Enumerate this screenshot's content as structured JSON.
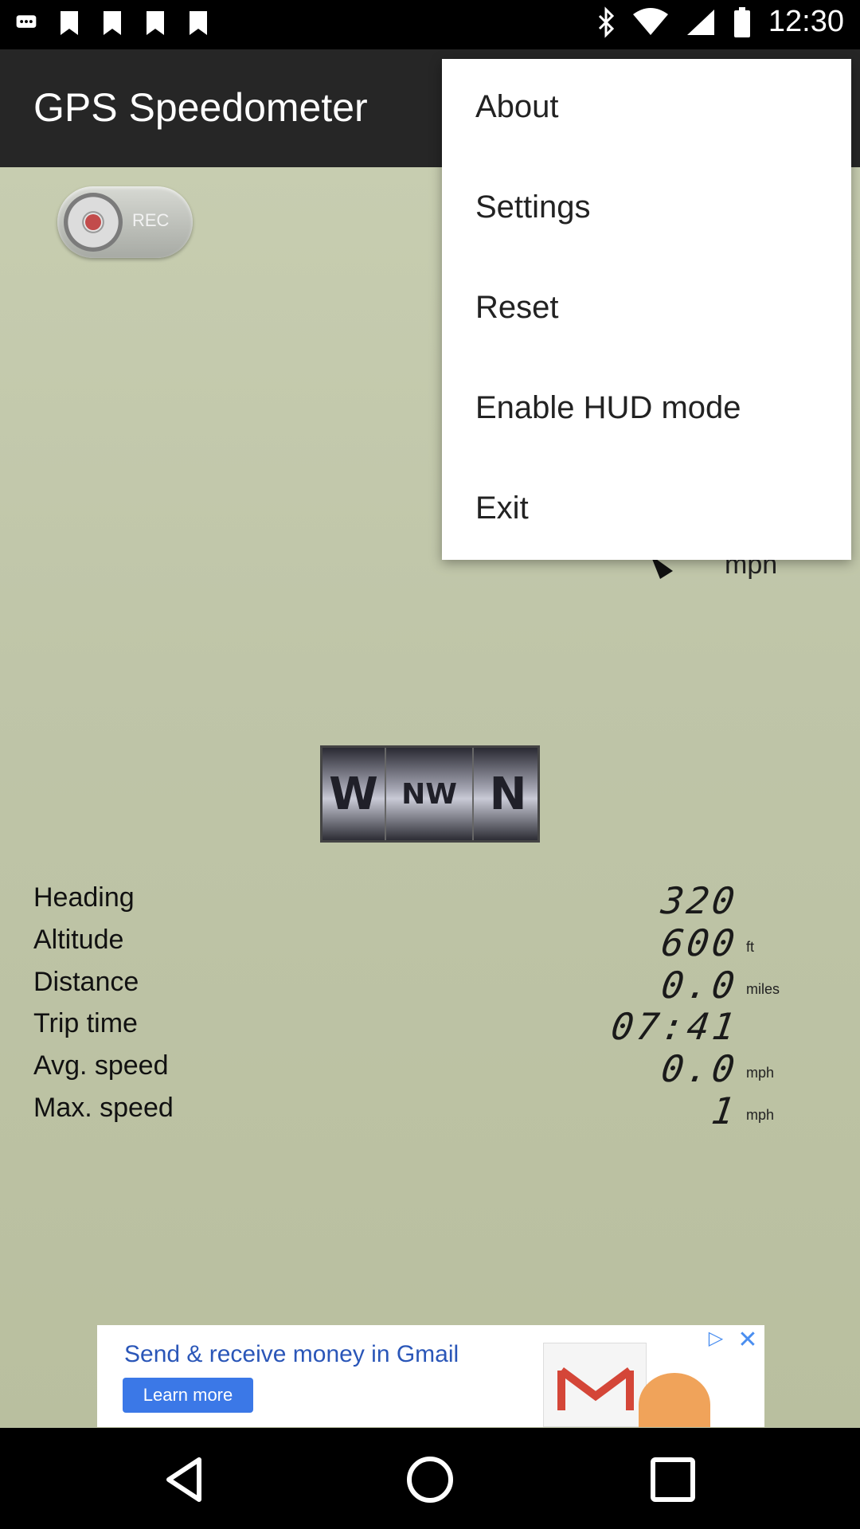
{
  "status_bar": {
    "time": "12:30",
    "icons": [
      "chat-icon",
      "image-icon",
      "image-icon",
      "image-icon",
      "image-icon",
      "bluetooth-icon",
      "wifi-icon",
      "signal-icon",
      "battery-icon"
    ]
  },
  "app_bar": {
    "title": "GPS Speedometer"
  },
  "rec_toggle": {
    "label": "REC"
  },
  "speed": {
    "unit": "mph"
  },
  "compass": {
    "left": "W",
    "center": "NW",
    "right": "N"
  },
  "stats": [
    {
      "label": "Heading",
      "value": "320",
      "unit": ""
    },
    {
      "label": "Altitude",
      "value": "600",
      "unit": "ft"
    },
    {
      "label": "Distance",
      "value": "0.0",
      "unit": "miles"
    },
    {
      "label": "Trip time",
      "value": "07:41",
      "unit": ""
    },
    {
      "label": "Avg. speed",
      "value": "0.0",
      "unit": "mph"
    },
    {
      "label": "Max. speed",
      "value": "1",
      "unit": "mph"
    }
  ],
  "ad": {
    "text": "Send & receive money in Gmail",
    "button": "Learn more"
  },
  "menu": {
    "items": [
      "About",
      "Settings",
      "Reset",
      "Enable HUD mode",
      "Exit"
    ]
  },
  "colors": {
    "background": "#c3c9ab",
    "app_bar": "#262626",
    "menu": "#ffffff"
  }
}
